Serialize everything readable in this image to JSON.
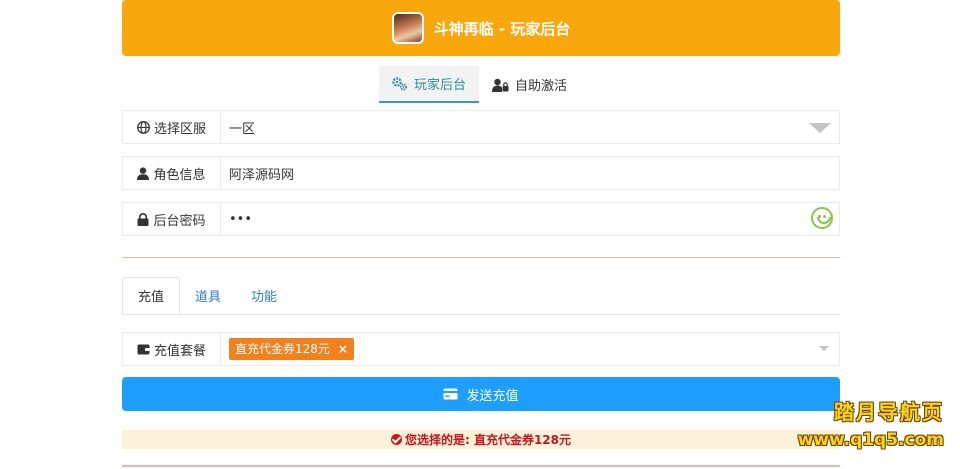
{
  "header": {
    "title": "斗神再临 - 玩家后台"
  },
  "top_tabs": [
    {
      "label": "玩家后台",
      "icon": "gears-icon",
      "active": true
    },
    {
      "label": "自助激活",
      "icon": "user-lock-icon",
      "active": false
    }
  ],
  "form": {
    "server": {
      "label": "选择区服",
      "icon": "globe-icon",
      "value": "一区"
    },
    "role": {
      "label": "角色信息",
      "icon": "user-icon",
      "value": "阿泽源码网"
    },
    "password": {
      "label": "后台密码",
      "icon": "lock-icon",
      "value": "•••"
    }
  },
  "sub_tabs": [
    {
      "label": "充值",
      "active": true
    },
    {
      "label": "道具",
      "active": false
    },
    {
      "label": "功能",
      "active": false
    }
  ],
  "package": {
    "label": "充值套餐",
    "icon": "wallet-icon",
    "selected_tag": "直充代金券128元",
    "remove": "×"
  },
  "send_button": {
    "label": "发送充值",
    "icon": "credit-card-icon"
  },
  "notice": {
    "text": "您选择的是: 直充代金券128元"
  },
  "watermark": {
    "line1": "踏月导航页",
    "line2": "www.q1q5.com"
  },
  "colors": {
    "header": "#f8a70d",
    "primary": "#1e9fff",
    "tag": "#f0811e",
    "notice_bg": "#fcf1d9",
    "notice_text": "#c4161c"
  }
}
